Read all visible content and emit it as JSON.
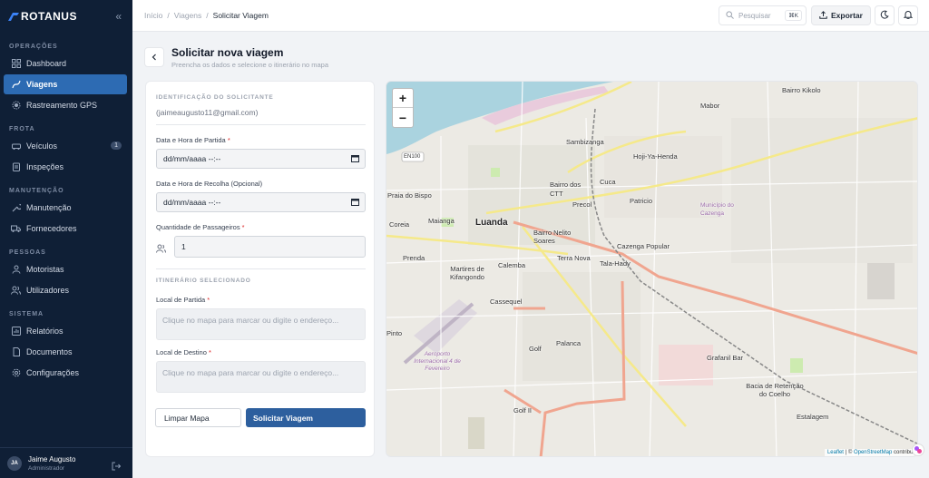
{
  "app": {
    "brand": "ROTANUS"
  },
  "sidebar": {
    "sections": [
      {
        "title": "OPERAÇÕES",
        "items": [
          {
            "label": "Dashboard",
            "icon": "grid-icon"
          },
          {
            "label": "Viagens",
            "icon": "route-icon",
            "active": true
          },
          {
            "label": "Rastreamento GPS",
            "icon": "gps-icon"
          }
        ]
      },
      {
        "title": "FROTA",
        "items": [
          {
            "label": "Veículos",
            "icon": "car-icon",
            "badge": "1"
          },
          {
            "label": "Inspeções",
            "icon": "clipboard-icon"
          }
        ]
      },
      {
        "title": "MANUTENÇÃO",
        "items": [
          {
            "label": "Manutenção",
            "icon": "wrench-icon"
          },
          {
            "label": "Fornecedores",
            "icon": "truck-icon"
          }
        ]
      },
      {
        "title": "PESSOAS",
        "items": [
          {
            "label": "Motoristas",
            "icon": "user-icon"
          },
          {
            "label": "Utilizadores",
            "icon": "users-icon"
          }
        ]
      },
      {
        "title": "SISTEMA",
        "items": [
          {
            "label": "Relatórios",
            "icon": "chart-icon"
          },
          {
            "label": "Documentos",
            "icon": "file-icon"
          },
          {
            "label": "Configurações",
            "icon": "gear-icon"
          }
        ]
      }
    ],
    "user": {
      "initials": "JA",
      "name": "Jaime Augusto",
      "role": "Administrador"
    }
  },
  "header": {
    "breadcrumb": [
      "Início",
      "Viagens",
      "Solicitar Viagem"
    ],
    "search_placeholder": "Pesquisar",
    "search_shortcut": "⌘K",
    "export_label": "Exportar"
  },
  "page": {
    "title": "Solicitar nova viagem",
    "subtitle": "Preencha os dados e selecione o itinerário no mapa"
  },
  "form": {
    "requester_section": "IDENTIFICAÇÃO DO SOLICITANTE",
    "requester_email": "(jaimeaugusto11@gmail.com)",
    "departure_label": "Data e Hora de Partida",
    "departure_value": "dd/mm/aaaa --:--",
    "pickup_label": "Data e Hora de Recolha (Opcional)",
    "pickup_value": "dd/mm/aaaa --:--",
    "passengers_label": "Quantidade de Passageiros",
    "passengers_value": "1",
    "itinerary_section": "ITINERÁRIO SELECIONADO",
    "origin_label": "Local de Partida",
    "origin_placeholder": "Clique no mapa para marcar ou digite o endereço...",
    "dest_label": "Local de Destino",
    "dest_placeholder": "Clique no mapa para marcar ou digite o endereço...",
    "required_mark": "*",
    "clear_label": "Limpar Mapa",
    "submit_label": "Solicitar Viagem"
  },
  "map": {
    "zoom_in": "+",
    "zoom_out": "−",
    "labels": [
      "Bairro Kikolo",
      "Mabor",
      "Sambizanga",
      "Hoji-Ya-Henda",
      "Bairro dos CTT",
      "Cuca",
      "Patricio",
      "Município do Cazenga",
      "Praia do Bispo",
      "Coreia",
      "Maianga",
      "Luanda",
      "Bairro Nelito Soares",
      "Precol",
      "Cazenga Popular",
      "Prenda",
      "Calemba",
      "Terra Nova",
      "Tala-Hady",
      "Martires de Kifangondo",
      "Cassequel",
      "Pinto",
      "Aeroporto Internacional 4 de Fevereiro",
      "Golf",
      "Palanca",
      "Grafanil Bar",
      "Bacia de Retenção do Coelho",
      "Golf II",
      "Estalagem",
      "EN100"
    ],
    "attribution_leaflet": "Leaflet",
    "attribution_sep": " | © ",
    "attribution_osm": "OpenStreetMap",
    "attribution_rest": " contribut"
  }
}
